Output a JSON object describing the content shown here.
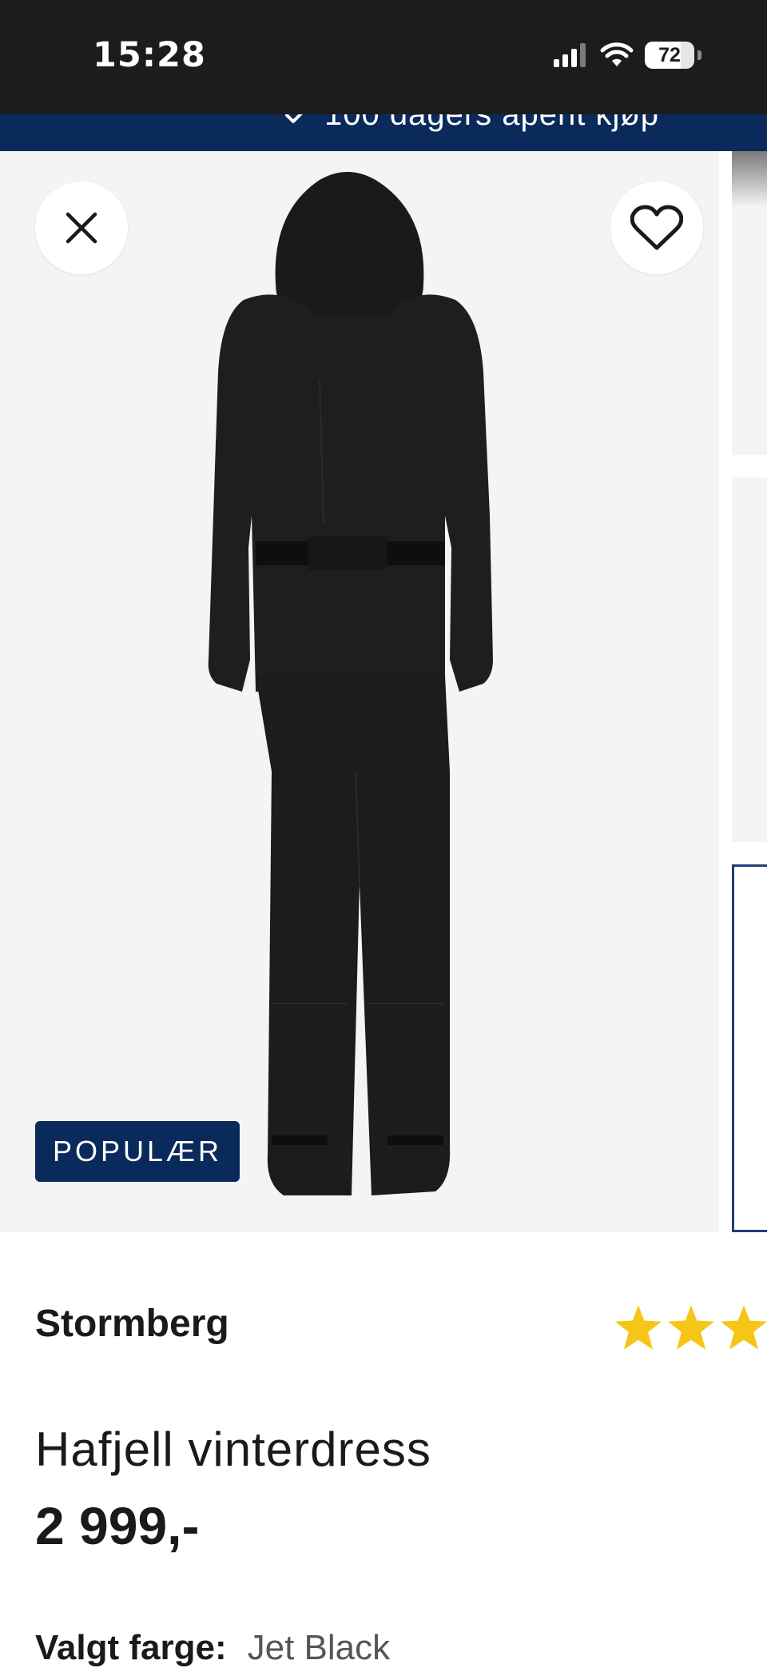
{
  "status_bar": {
    "time": "15:28",
    "battery_level": "72",
    "icons": [
      "cellular-signal-icon",
      "wifi-icon",
      "battery-icon"
    ]
  },
  "promo_banner": {
    "text": "100 dagers åpent kjøp",
    "icon": "checkmark-icon"
  },
  "gallery": {
    "badge": "POPULÆR",
    "close_icon": "close-icon",
    "favorite_icon": "heart-icon"
  },
  "product": {
    "brand": "Stormberg",
    "name": "Hafjell vinterdress",
    "price": "2 999,-",
    "rating_icon": "star-icon",
    "selected_color_label": "Valgt farge:",
    "selected_color_value": "Jet Black"
  },
  "colors": {
    "banner": "#0a2a5c",
    "star": "#f5c518",
    "image_bg": "#f4f4f4"
  }
}
